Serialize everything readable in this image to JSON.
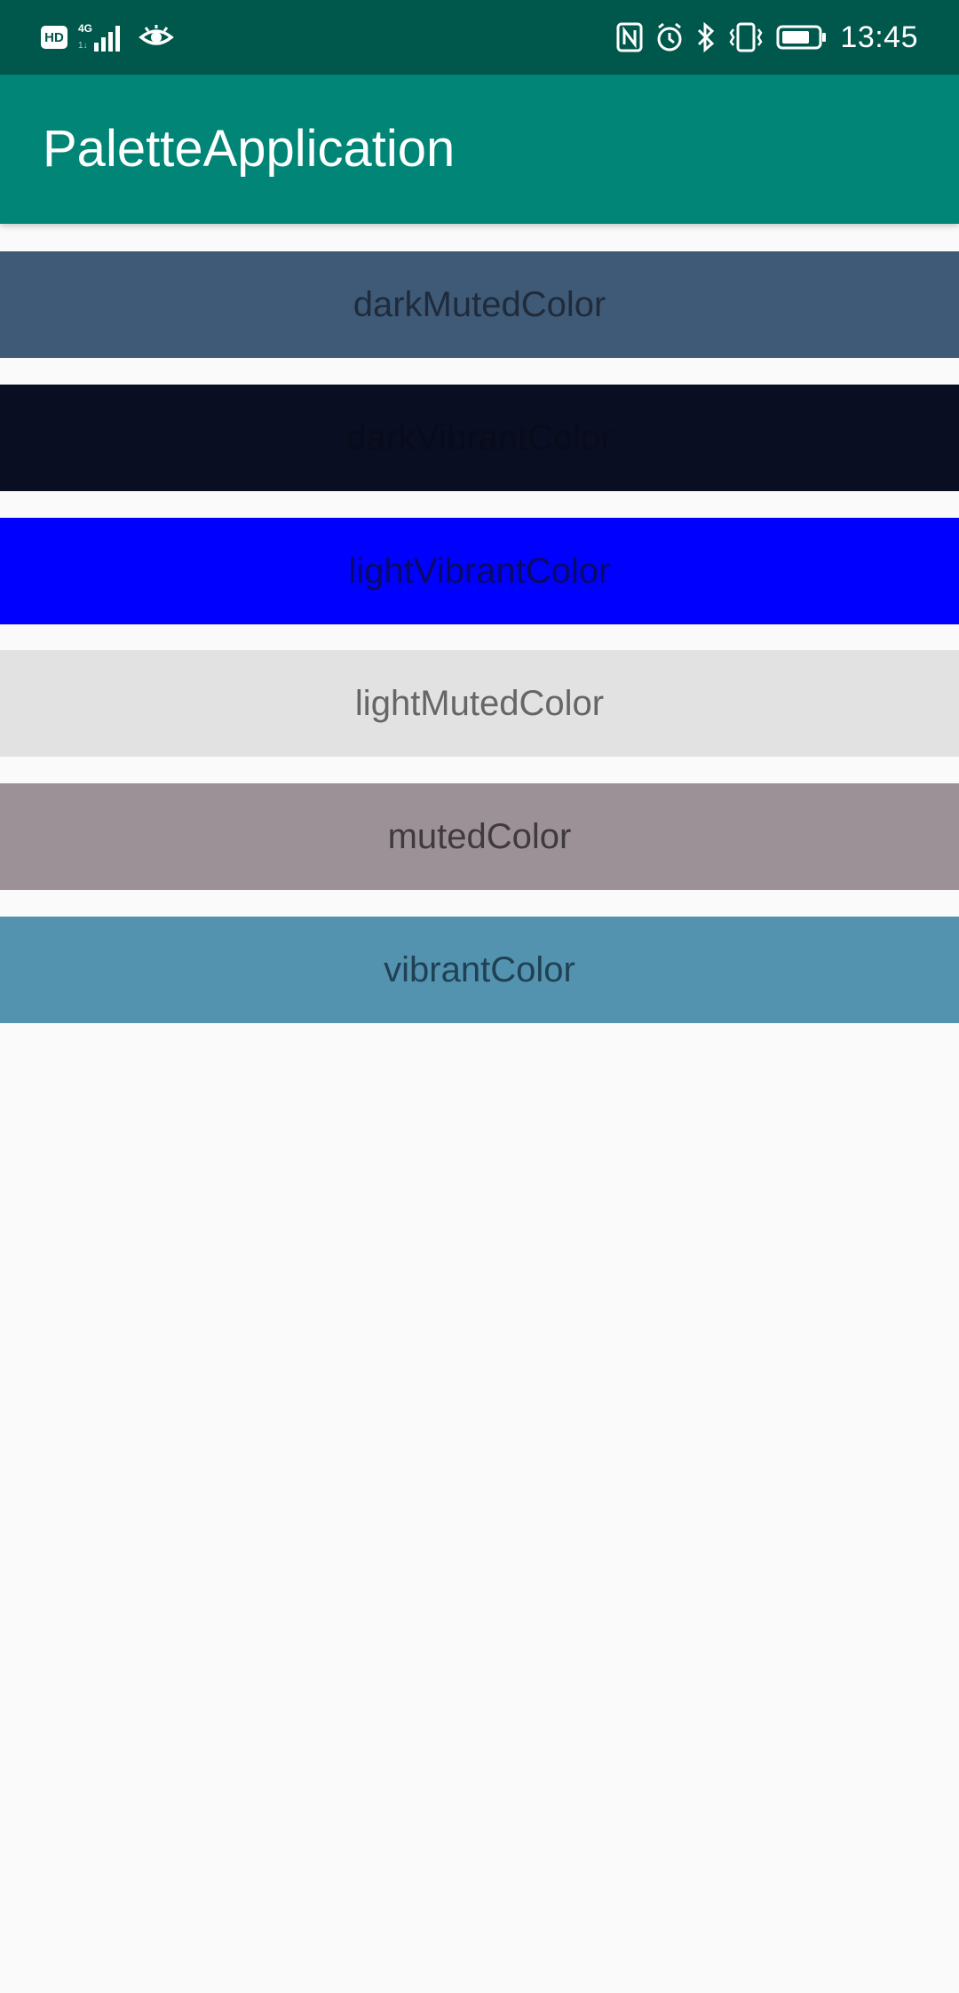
{
  "status_bar": {
    "hd": "HD",
    "network": "4G",
    "time": "13:45",
    "icons": [
      "hd-icon",
      "signal-icon",
      "eye-icon",
      "nfc-icon",
      "alarm-icon",
      "bluetooth-icon",
      "vibrate-icon",
      "battery-icon"
    ]
  },
  "app_bar": {
    "title": "PaletteApplication"
  },
  "swatches": [
    {
      "label": "darkMutedColor",
      "color": "#3f5a76"
    },
    {
      "label": "darkVibrantColor",
      "color": "#0a0e22"
    },
    {
      "label": "lightVibrantColor",
      "color": "#0000ff"
    },
    {
      "label": "lightMutedColor",
      "color": "#e2e2e2"
    },
    {
      "label": "mutedColor",
      "color": "#9c9197"
    },
    {
      "label": "vibrantColor",
      "color": "#5393b0"
    }
  ],
  "colors": {
    "status_bar": "#00574b",
    "app_bar": "#008577",
    "background": "#fafafa"
  }
}
